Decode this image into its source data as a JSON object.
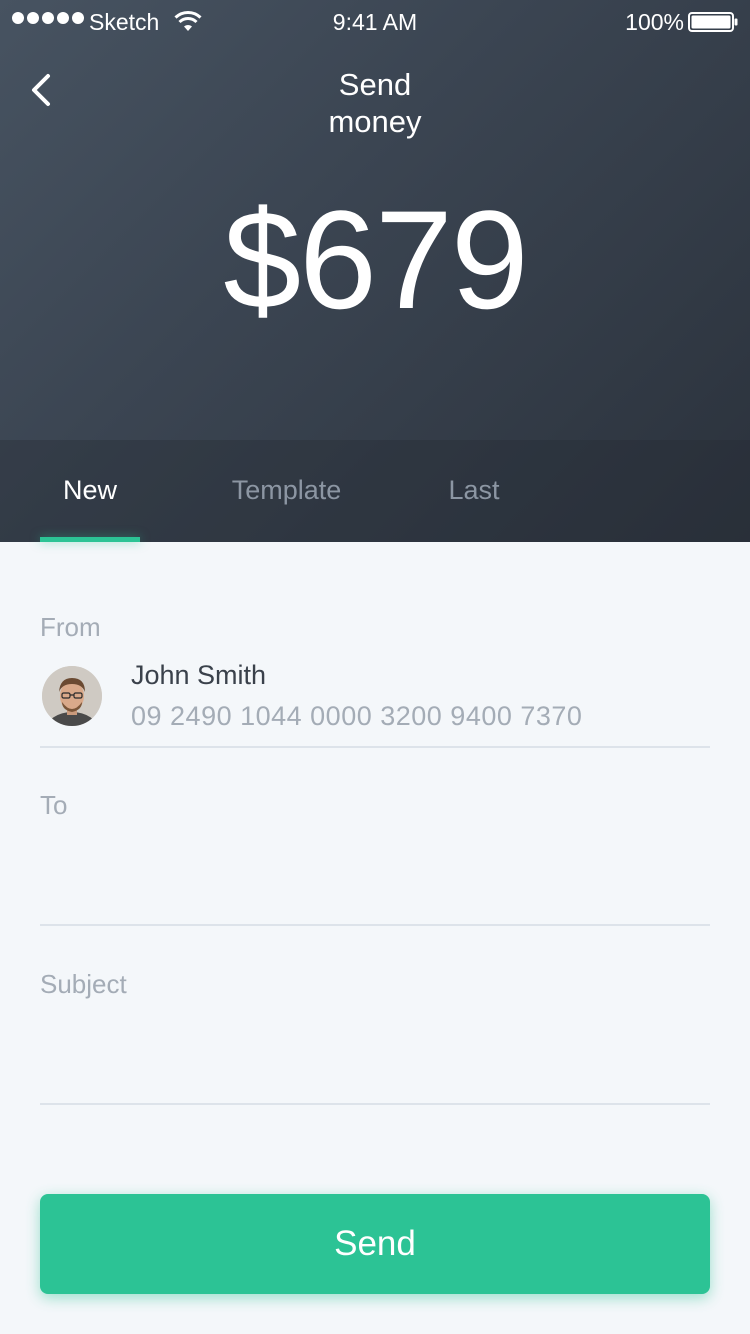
{
  "status_bar": {
    "carrier": "Sketch",
    "time": "9:41 AM",
    "battery": "100%"
  },
  "header": {
    "title_line1": "Send",
    "title_line2": "money",
    "amount": "$679"
  },
  "tabs": [
    {
      "label": "New",
      "active": true
    },
    {
      "label": "Template",
      "active": false
    },
    {
      "label": "Last",
      "active": false
    }
  ],
  "form": {
    "from": {
      "label": "From",
      "name": "John Smith",
      "account": "09 2490 1044 0000 3200 9400 7370"
    },
    "to": {
      "label": "To",
      "value": ""
    },
    "subject": {
      "label": "Subject",
      "value": ""
    }
  },
  "send_button": {
    "label": "Send"
  },
  "colors": {
    "accent": "#2cc395",
    "header_dark": "#2b323c",
    "background": "#f4f7fa"
  }
}
